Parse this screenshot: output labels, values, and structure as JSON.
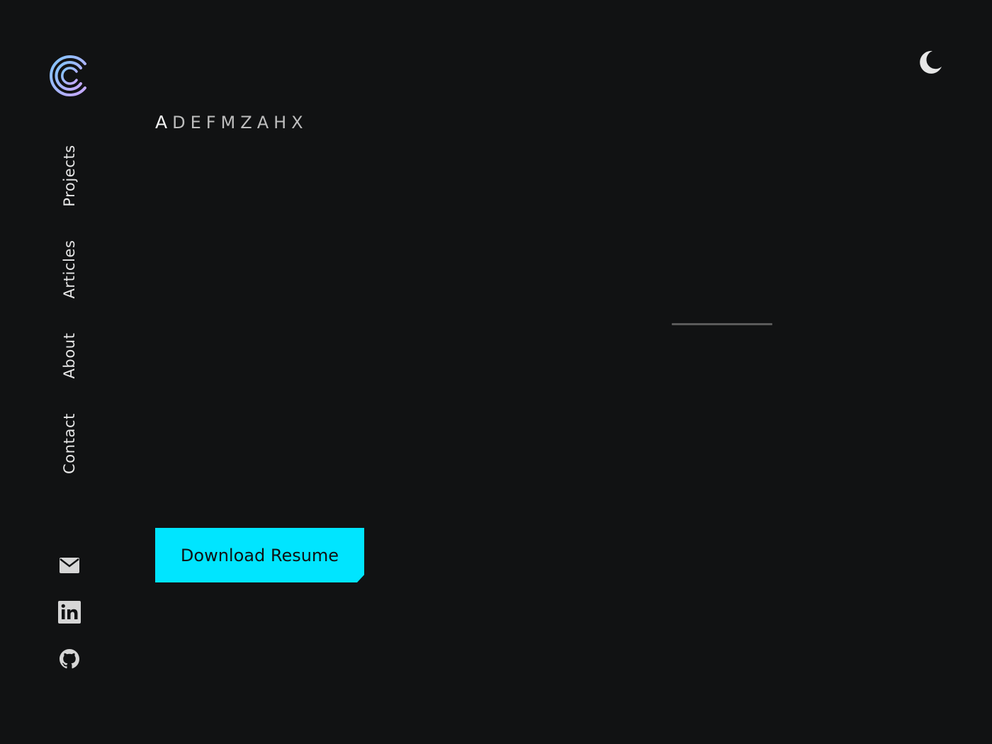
{
  "header": {
    "logo_icon": "c-logo-icon",
    "theme_toggle_icon": "moon-icon"
  },
  "nav": {
    "items": [
      {
        "label": "Projects"
      },
      {
        "label": "Articles"
      },
      {
        "label": "About"
      },
      {
        "label": "Contact"
      }
    ]
  },
  "social": {
    "icons": [
      "email-icon",
      "linkedin-icon",
      "github-icon"
    ]
  },
  "hero": {
    "scramble_first": "A",
    "scramble_rest": "DEFMZAHX"
  },
  "cta": {
    "download_label": "Download Resume"
  },
  "colors": {
    "background": "#111213",
    "accent": "#00e5ff",
    "text": "#e6e6e6",
    "muted": "#bdbdbd",
    "logo_gradient_start": "#8fb7ff",
    "logo_gradient_end": "#c3a8ff"
  }
}
